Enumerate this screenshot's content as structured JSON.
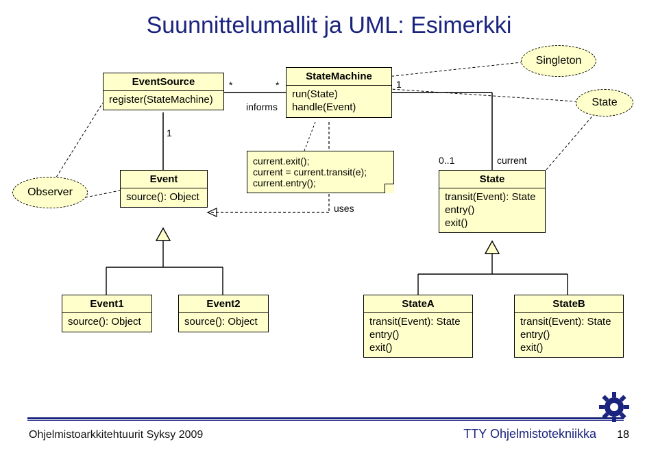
{
  "title": "Suunnittelumallit ja UML: Esimerkki",
  "patterns": {
    "observer": "Observer",
    "singleton": "Singleton",
    "state": "State"
  },
  "classes": {
    "eventSource": {
      "name": "EventSource",
      "ops": "register(StateMachine)"
    },
    "stateMachine": {
      "name": "StateMachine",
      "ops1": "run(State)",
      "ops2": "handle(Event)"
    },
    "event": {
      "name": "Event",
      "ops": "source(): Object"
    },
    "state": {
      "name": "State",
      "ops1": "transit(Event): State",
      "ops2": "entry()",
      "ops3": "exit()"
    },
    "event1": {
      "name": "Event1",
      "ops": "source(): Object"
    },
    "event2": {
      "name": "Event2",
      "ops": "source(): Object"
    },
    "stateA": {
      "name": "StateA",
      "ops1": "transit(Event): State",
      "ops2": "entry()",
      "ops3": "exit()"
    },
    "stateB": {
      "name": "StateB",
      "ops1": "transit(Event): State",
      "ops2": "entry()",
      "ops3": "exit()"
    }
  },
  "note": {
    "line1": "current.exit();",
    "line2": "current = current.transit(e);",
    "line3": "current.entry();"
  },
  "assoc": {
    "informs": "informs",
    "starLeft": "*",
    "starRight": "*",
    "one_sm_state": "1",
    "one_event_src": "1",
    "uses": "uses",
    "mult_state": "0..1",
    "role_state": "current"
  },
  "footer": {
    "left": "Ohjelmistoarkkitehtuurit  Syksy 2009",
    "right": "TTY Ohjelmistotekniikka",
    "page": "18"
  },
  "chart_data": {
    "type": "uml-class-diagram",
    "title": "Suunnittelumallit ja UML: Esimerkki",
    "design_patterns": [
      {
        "name": "Observer",
        "applies_to": [
          "EventSource",
          "Event"
        ]
      },
      {
        "name": "Singleton",
        "applies_to": [
          "StateMachine"
        ]
      },
      {
        "name": "State",
        "applies_to": [
          "StateMachine",
          "State"
        ]
      }
    ],
    "classes": [
      {
        "name": "EventSource",
        "operations": [
          "register(StateMachine)"
        ]
      },
      {
        "name": "StateMachine",
        "operations": [
          "run(State)",
          "handle(Event)"
        ],
        "note": "current.exit(); current = current.transit(e); current.entry();"
      },
      {
        "name": "Event",
        "operations": [
          "source(): Object"
        ]
      },
      {
        "name": "State",
        "operations": [
          "transit(Event): State",
          "entry()",
          "exit()"
        ]
      },
      {
        "name": "Event1",
        "operations": [
          "source(): Object"
        ]
      },
      {
        "name": "Event2",
        "operations": [
          "source(): Object"
        ]
      },
      {
        "name": "StateA",
        "operations": [
          "transit(Event): State",
          "entry()",
          "exit()"
        ]
      },
      {
        "name": "StateB",
        "operations": [
          "transit(Event): State",
          "entry()",
          "exit()"
        ]
      }
    ],
    "relationships": [
      {
        "type": "association",
        "from": "EventSource",
        "to": "StateMachine",
        "name": "informs",
        "from_mult": "*",
        "to_mult": "*"
      },
      {
        "type": "association",
        "from": "EventSource",
        "to": "Event",
        "to_mult": "1"
      },
      {
        "type": "dependency",
        "from": "StateMachine",
        "to": "Event",
        "name": "uses"
      },
      {
        "type": "association",
        "from": "StateMachine",
        "to": "State",
        "from_mult": "1",
        "to_mult": "0..1",
        "role": "current"
      },
      {
        "type": "generalization",
        "from": "Event1",
        "to": "Event"
      },
      {
        "type": "generalization",
        "from": "Event2",
        "to": "Event"
      },
      {
        "type": "generalization",
        "from": "StateA",
        "to": "State"
      },
      {
        "type": "generalization",
        "from": "StateB",
        "to": "State"
      }
    ]
  }
}
